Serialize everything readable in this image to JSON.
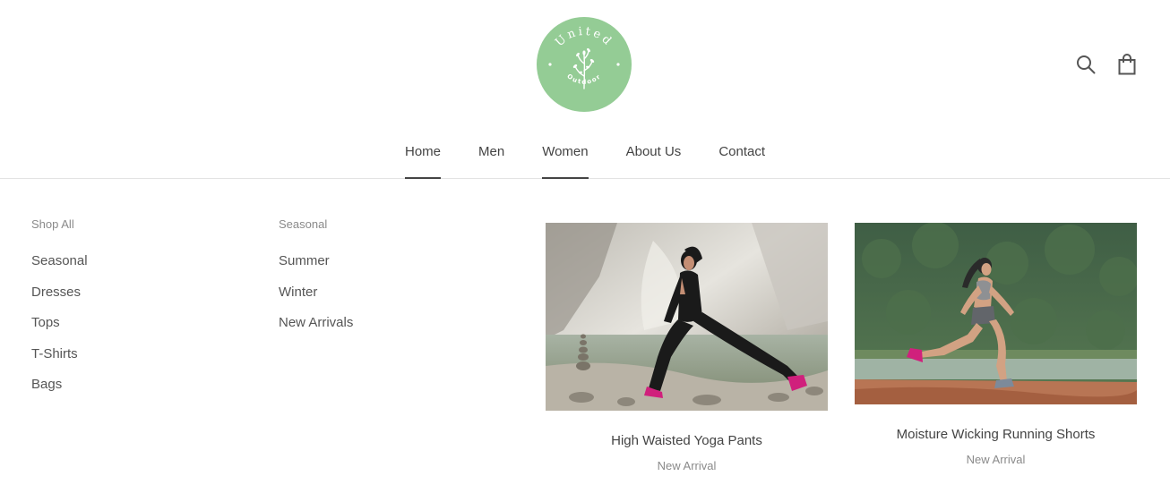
{
  "brand": {
    "logo_top_text": "United",
    "logo_bottom_text": "Outdoor",
    "logo_color": "#94cc95"
  },
  "header": {
    "icons": [
      "search-icon",
      "shopping-bag-icon"
    ]
  },
  "nav": {
    "items": [
      {
        "label": "Home",
        "active": true
      },
      {
        "label": "Men",
        "active": false
      },
      {
        "label": "Women",
        "active": true
      },
      {
        "label": "About Us",
        "active": false
      },
      {
        "label": "Contact",
        "active": false
      }
    ]
  },
  "mega_menu": {
    "columns": [
      {
        "title": "Shop All",
        "links": [
          "Seasonal",
          "Dresses",
          "Tops",
          "T-Shirts",
          "Bags"
        ]
      },
      {
        "title": "Seasonal",
        "links": [
          "Summer",
          "Winter",
          "New Arrivals"
        ]
      }
    ],
    "featured": [
      {
        "title": "High Waisted Yoga Pants",
        "subtitle": "New Arrival"
      },
      {
        "title": "Moisture Wicking Running Shorts",
        "subtitle": "New Arrival"
      }
    ]
  },
  "colors": {
    "text": "#444444",
    "muted": "#8a8a8a",
    "border": "#e3e3e3",
    "accent_shoe": "#d0207c"
  }
}
